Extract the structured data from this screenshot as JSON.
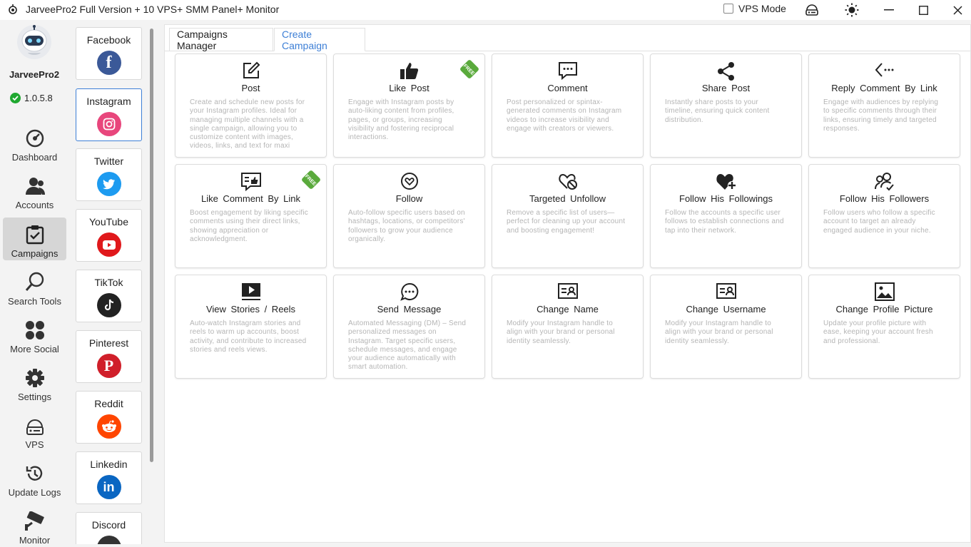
{
  "window": {
    "title": "JarveePro2 Full Version + 10 VPS+ SMM Panel+ Monitor",
    "vps_mode_label": "VPS Mode"
  },
  "sidebar": {
    "brand": "JarveePro2",
    "version": "1.0.5.8",
    "items": [
      {
        "label": "Dashboard",
        "icon": "dashboard-icon"
      },
      {
        "label": "Accounts",
        "icon": "accounts-icon"
      },
      {
        "label": "Campaigns",
        "icon": "campaigns-icon",
        "active": true
      },
      {
        "label": "Search Tools",
        "icon": "search-icon"
      },
      {
        "label": "More Social",
        "icon": "more-social-icon"
      },
      {
        "label": "Settings",
        "icon": "gear-icon"
      },
      {
        "label": "VPS",
        "icon": "vps-icon"
      },
      {
        "label": "Update Logs",
        "icon": "update-logs-icon"
      },
      {
        "label": "Monitor",
        "icon": "monitor-camera-icon"
      }
    ]
  },
  "social": [
    {
      "label": "Facebook",
      "color": "#3b5998",
      "glyph": "f"
    },
    {
      "label": "Instagram",
      "color": "#e8467c",
      "glyph": "◎",
      "selected": true
    },
    {
      "label": "Twitter",
      "color": "#1d9bf0",
      "glyph": "t"
    },
    {
      "label": "YouTube",
      "color": "#e0181b",
      "glyph": "▶"
    },
    {
      "label": "TikTok",
      "color": "#222222",
      "glyph": "♪"
    },
    {
      "label": "Pinterest",
      "color": "#d01f2a",
      "glyph": "P"
    },
    {
      "label": "Reddit",
      "color": "#ff4500",
      "glyph": "☻"
    },
    {
      "label": "Linkedin",
      "color": "#0a66c2",
      "glyph": "in"
    },
    {
      "label": "Discord",
      "color": "#333333",
      "glyph": "d"
    }
  ],
  "tabs": [
    "Campaigns Manager",
    "Create Campaign"
  ],
  "free_badge": "FREE",
  "cards": [
    {
      "title": "Post",
      "icon": "edit-icon",
      "desc": "Create and schedule new posts for your Instagram profiles. Ideal for managing multiple channels with a single campaign, allowing you to customize content with images, videos, links, and text for maxi"
    },
    {
      "title": "Like  Post",
      "icon": "thumbs-up-icon",
      "free": true,
      "desc": "Engage with Instagram posts by auto-liking content from profiles, pages, or groups, increasing visibility and fostering reciprocal interactions."
    },
    {
      "title": "Comment",
      "icon": "comment-icon",
      "desc": "Post personalized or spintax-generated comments on Instagram videos to increase visibility and engage with creators or viewers."
    },
    {
      "title": "Share  Post",
      "icon": "share-icon",
      "desc": "Instantly share posts to your timeline, ensuring quick content distribution."
    },
    {
      "title": "Reply  Comment  By  Link",
      "icon": "reply-icon",
      "desc": "Engage with audiences by replying to specific comments through their links, ensuring timely and targeted responses."
    },
    {
      "title": "Like  Comment  By  Link",
      "icon": "like-comment-icon",
      "free": true,
      "desc": "Boost engagement by liking specific comments using their direct links, showing appreciation or acknowledgment."
    },
    {
      "title": "Follow",
      "icon": "follow-heart-icon",
      "desc": "Auto-follow specific users based on hashtags, locations, or competitors' followers to grow your audience organically."
    },
    {
      "title": "Targeted  Unfollow",
      "icon": "unfollow-icon",
      "desc": "Remove a specific list of users—perfect for cleaning up your account and boosting engagement!"
    },
    {
      "title": "Follow  His  Followings",
      "icon": "heart-plus-icon",
      "desc": "Follow the accounts a specific user follows to establish connections and tap into their network."
    },
    {
      "title": "Follow  His  Followers",
      "icon": "users-check-icon",
      "desc": "Follow users who follow a specific account to target an already engaged audience in your niche."
    },
    {
      "title": "View  Stories /  Reels",
      "icon": "play-icon",
      "desc": "Auto-watch Instagram stories and reels to warm up accounts, boost activity, and contribute to increased stories and reels views."
    },
    {
      "title": "Send  Message",
      "icon": "message-icon",
      "desc": "Automated Messaging (DM) – Send personalized messages on Instagram. Target specific users, schedule messages, and engage your audience automatically with smart automation."
    },
    {
      "title": "Change  Name",
      "icon": "id-card-icon",
      "desc": "Modify your Instagram handle to align with your brand or personal identity seamlessly."
    },
    {
      "title": "Change  Username",
      "icon": "id-card-icon",
      "desc": "Modify your Instagram handle to align with your brand or personal identity seamlessly."
    },
    {
      "title": "Change  Profile  Picture",
      "icon": "picture-icon",
      "desc": "Update your profile picture with ease, keeping your account fresh and professional."
    }
  ]
}
